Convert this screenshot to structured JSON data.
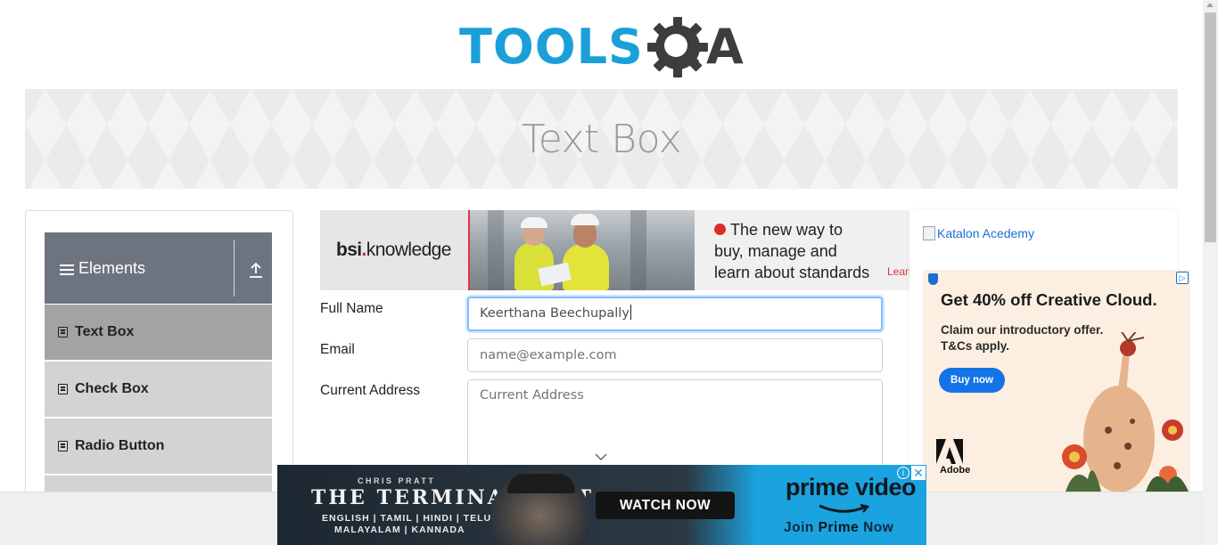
{
  "site": {
    "logo_text": "TOOLS",
    "logo_suffix": "A"
  },
  "header": {
    "title": "Text Box"
  },
  "sidebar": {
    "group_title": "Elements",
    "items": [
      {
        "label": "Text Box",
        "active": true
      },
      {
        "label": "Check Box",
        "active": false
      },
      {
        "label": "Radio Button",
        "active": false
      }
    ]
  },
  "form": {
    "full_name_label": "Full Name",
    "full_name_value": "Keerthana Beechupally",
    "email_label": "Email",
    "email_placeholder": "name@example.com",
    "address_label": "Current Address",
    "address_placeholder": "Current Address"
  },
  "ads": {
    "top": {
      "brand_left": "bsi",
      "brand_dot": ".",
      "brand_right": "knowledge",
      "line1": "The new way to",
      "line2": "buy, manage and",
      "line3": "learn about standards",
      "cta": "Learn"
    },
    "side_link": "Katalon Acedemy",
    "adobe": {
      "headline": "Get 40% off Creative Cloud.",
      "sub1": "Claim our introductory offer.",
      "sub2": "T&Cs apply.",
      "button": "Buy now",
      "brand": "Adobe"
    },
    "bottom": {
      "actor": "CHRIS PRATT",
      "title": "THE TERMINAL LIST",
      "languages1": "ENGLISH | TAMIL | HINDI | TELUGU",
      "languages2": "MALAYALAM | KANNADA",
      "button": "WATCH NOW",
      "brand": "prime video",
      "tagline_pre": "Join ",
      "tagline_bold": "Prime",
      "tagline_post": " Now"
    }
  },
  "colors": {
    "brand_blue": "#1b9fd9",
    "menu_header": "#6d7480",
    "menu_item": "#d3d3d3",
    "menu_active": "#a3a3a3",
    "focus": "#80bdff"
  }
}
